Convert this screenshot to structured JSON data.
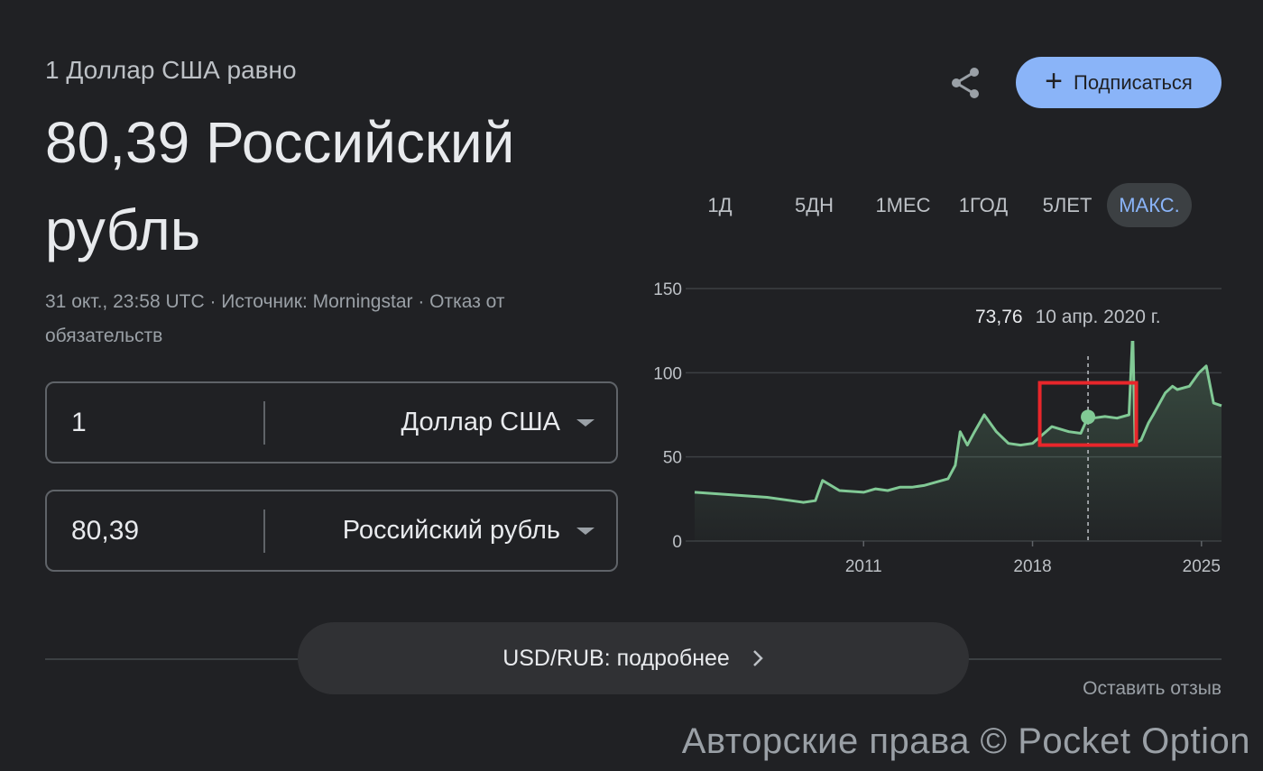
{
  "header": {
    "subtitle": "1 Доллар США равно",
    "main_value": "80,39 Российский рубль",
    "meta": "31 окт., 23:58 UTC · Источник: Morningstar · Отказ от обязательств"
  },
  "actions": {
    "share_icon": "share-icon",
    "subscribe_label": "Подписаться",
    "subscribe_icon": "plus-icon"
  },
  "converter": {
    "from": {
      "amount": "1",
      "currency": "Доллар США"
    },
    "to": {
      "amount": "80,39",
      "currency": "Российский рубль"
    }
  },
  "range_tabs": [
    {
      "label": "1Д",
      "active": false
    },
    {
      "label": "5ДН",
      "active": false
    },
    {
      "label": "1МЕС",
      "active": false
    },
    {
      "label": "1ГОД",
      "active": false
    },
    {
      "label": "5ЛЕТ",
      "active": false
    },
    {
      "label": "МАКС.",
      "active": true
    }
  ],
  "tooltip": {
    "value": "73,76",
    "date": "10 апр. 2020 г."
  },
  "footer": {
    "more_label": "USD/RUB: подробнее",
    "feedback_label": "Оставить отзыв",
    "watermark": "Авторские права © Pocket Option"
  },
  "colors": {
    "accent": "#8ab4f8",
    "line": "#81c995",
    "highlight_box": "#e8262b",
    "background": "#202124"
  },
  "chart_data": {
    "type": "area",
    "x": [
      2004.0,
      2005.0,
      2006.0,
      2007.0,
      2008.0,
      2008.5,
      2009.0,
      2009.3,
      2010.0,
      2011.0,
      2011.5,
      2012.0,
      2012.5,
      2013.0,
      2013.5,
      2014.0,
      2014.5,
      2014.8,
      2015.0,
      2015.3,
      2015.6,
      2016.0,
      2016.5,
      2017.0,
      2017.5,
      2018.0,
      2018.4,
      2018.8,
      2019.5,
      2020.0,
      2020.3,
      2020.5,
      2021.0,
      2021.5,
      2022.0,
      2022.15,
      2022.25,
      2022.5,
      2022.8,
      2023.0,
      2023.5,
      2023.8,
      2024.0,
      2024.5,
      2024.9,
      2025.2,
      2025.5,
      2025.83
    ],
    "y": [
      29,
      28,
      27,
      26,
      24,
      23,
      24,
      36,
      30,
      29,
      31,
      30,
      32,
      32,
      33,
      35,
      37,
      45,
      65,
      57,
      65,
      75,
      65,
      58,
      57,
      58,
      63,
      68,
      65,
      64,
      73.76,
      73,
      74,
      73,
      75,
      125,
      58,
      60,
      70,
      75,
      88,
      92,
      90,
      92,
      100,
      104,
      82,
      80.39
    ],
    "xlabel": "",
    "ylabel": "",
    "y_ticks": [
      0,
      50,
      100,
      150
    ],
    "x_ticks": [
      2011,
      2018,
      2025
    ],
    "ylim": [
      0,
      150
    ],
    "xlim": [
      2004,
      2025.83
    ],
    "marker": {
      "x": 2020.3,
      "y": 73.76
    },
    "highlight": {
      "x0": 2018.3,
      "x0_end": 2022.3,
      "y_min": 57,
      "y_max": 94
    },
    "grid": true
  }
}
